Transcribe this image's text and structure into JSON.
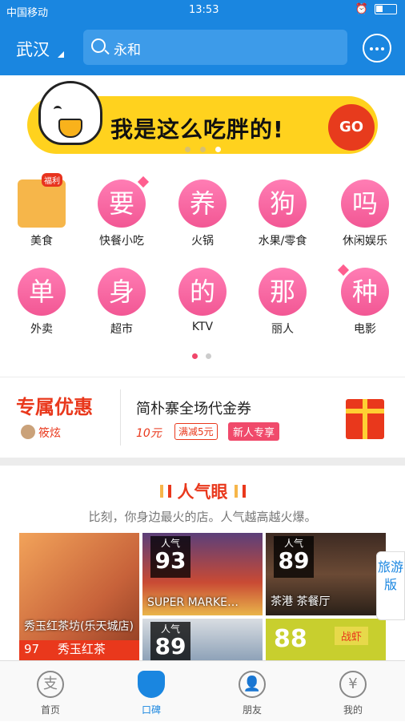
{
  "status_bar": {
    "carrier": "中国移动",
    "time": "13:53"
  },
  "header": {
    "city": "武汉",
    "search_placeholder": "永和"
  },
  "banner": {
    "text": "我是这么吃胖的!",
    "go_label": "GO"
  },
  "categories": [
    {
      "char": "",
      "label": "美食",
      "badge": "福利"
    },
    {
      "char": "要",
      "label": "快餐小吃"
    },
    {
      "char": "养",
      "label": "火锅"
    },
    {
      "char": "狗",
      "label": "水果/零食"
    },
    {
      "char": "吗",
      "label": "休闲娱乐"
    },
    {
      "char": "单",
      "label": "外卖"
    },
    {
      "char": "身",
      "label": "超市"
    },
    {
      "char": "的",
      "label": "KTV"
    },
    {
      "char": "那",
      "label": "丽人"
    },
    {
      "char": "种",
      "label": "电影"
    }
  ],
  "promo": {
    "title": "专属优惠",
    "brand": "筱炫",
    "main": "简朴寨全场代金券",
    "price": "10元",
    "condition": "满减5元",
    "new_tag": "新人专享"
  },
  "hot": {
    "title": "人气眼",
    "subtitle": "比刻，你身边最火的店。人气越高越火爆。"
  },
  "tiles": [
    {
      "name": "秀玉红茶坊(乐天城店)",
      "score_label": "",
      "score": "97",
      "sub": "秀玉红茶"
    },
    {
      "name": "SUPER MARKE…",
      "score_label": "人气",
      "score": "93"
    },
    {
      "name": "茶港 茶餐厅",
      "score_label": "人气",
      "score": "89"
    },
    {
      "name": "",
      "score_label": "人气",
      "score": "89"
    },
    {
      "name": "战虾",
      "score_label": "",
      "score": "88"
    }
  ],
  "side_badge": "旅游版",
  "tabs": [
    {
      "label": "首页",
      "icon": "支"
    },
    {
      "label": "口碑",
      "icon": ""
    },
    {
      "label": "朋友",
      "icon": "👤"
    },
    {
      "label": "我的",
      "icon": "¥"
    }
  ]
}
